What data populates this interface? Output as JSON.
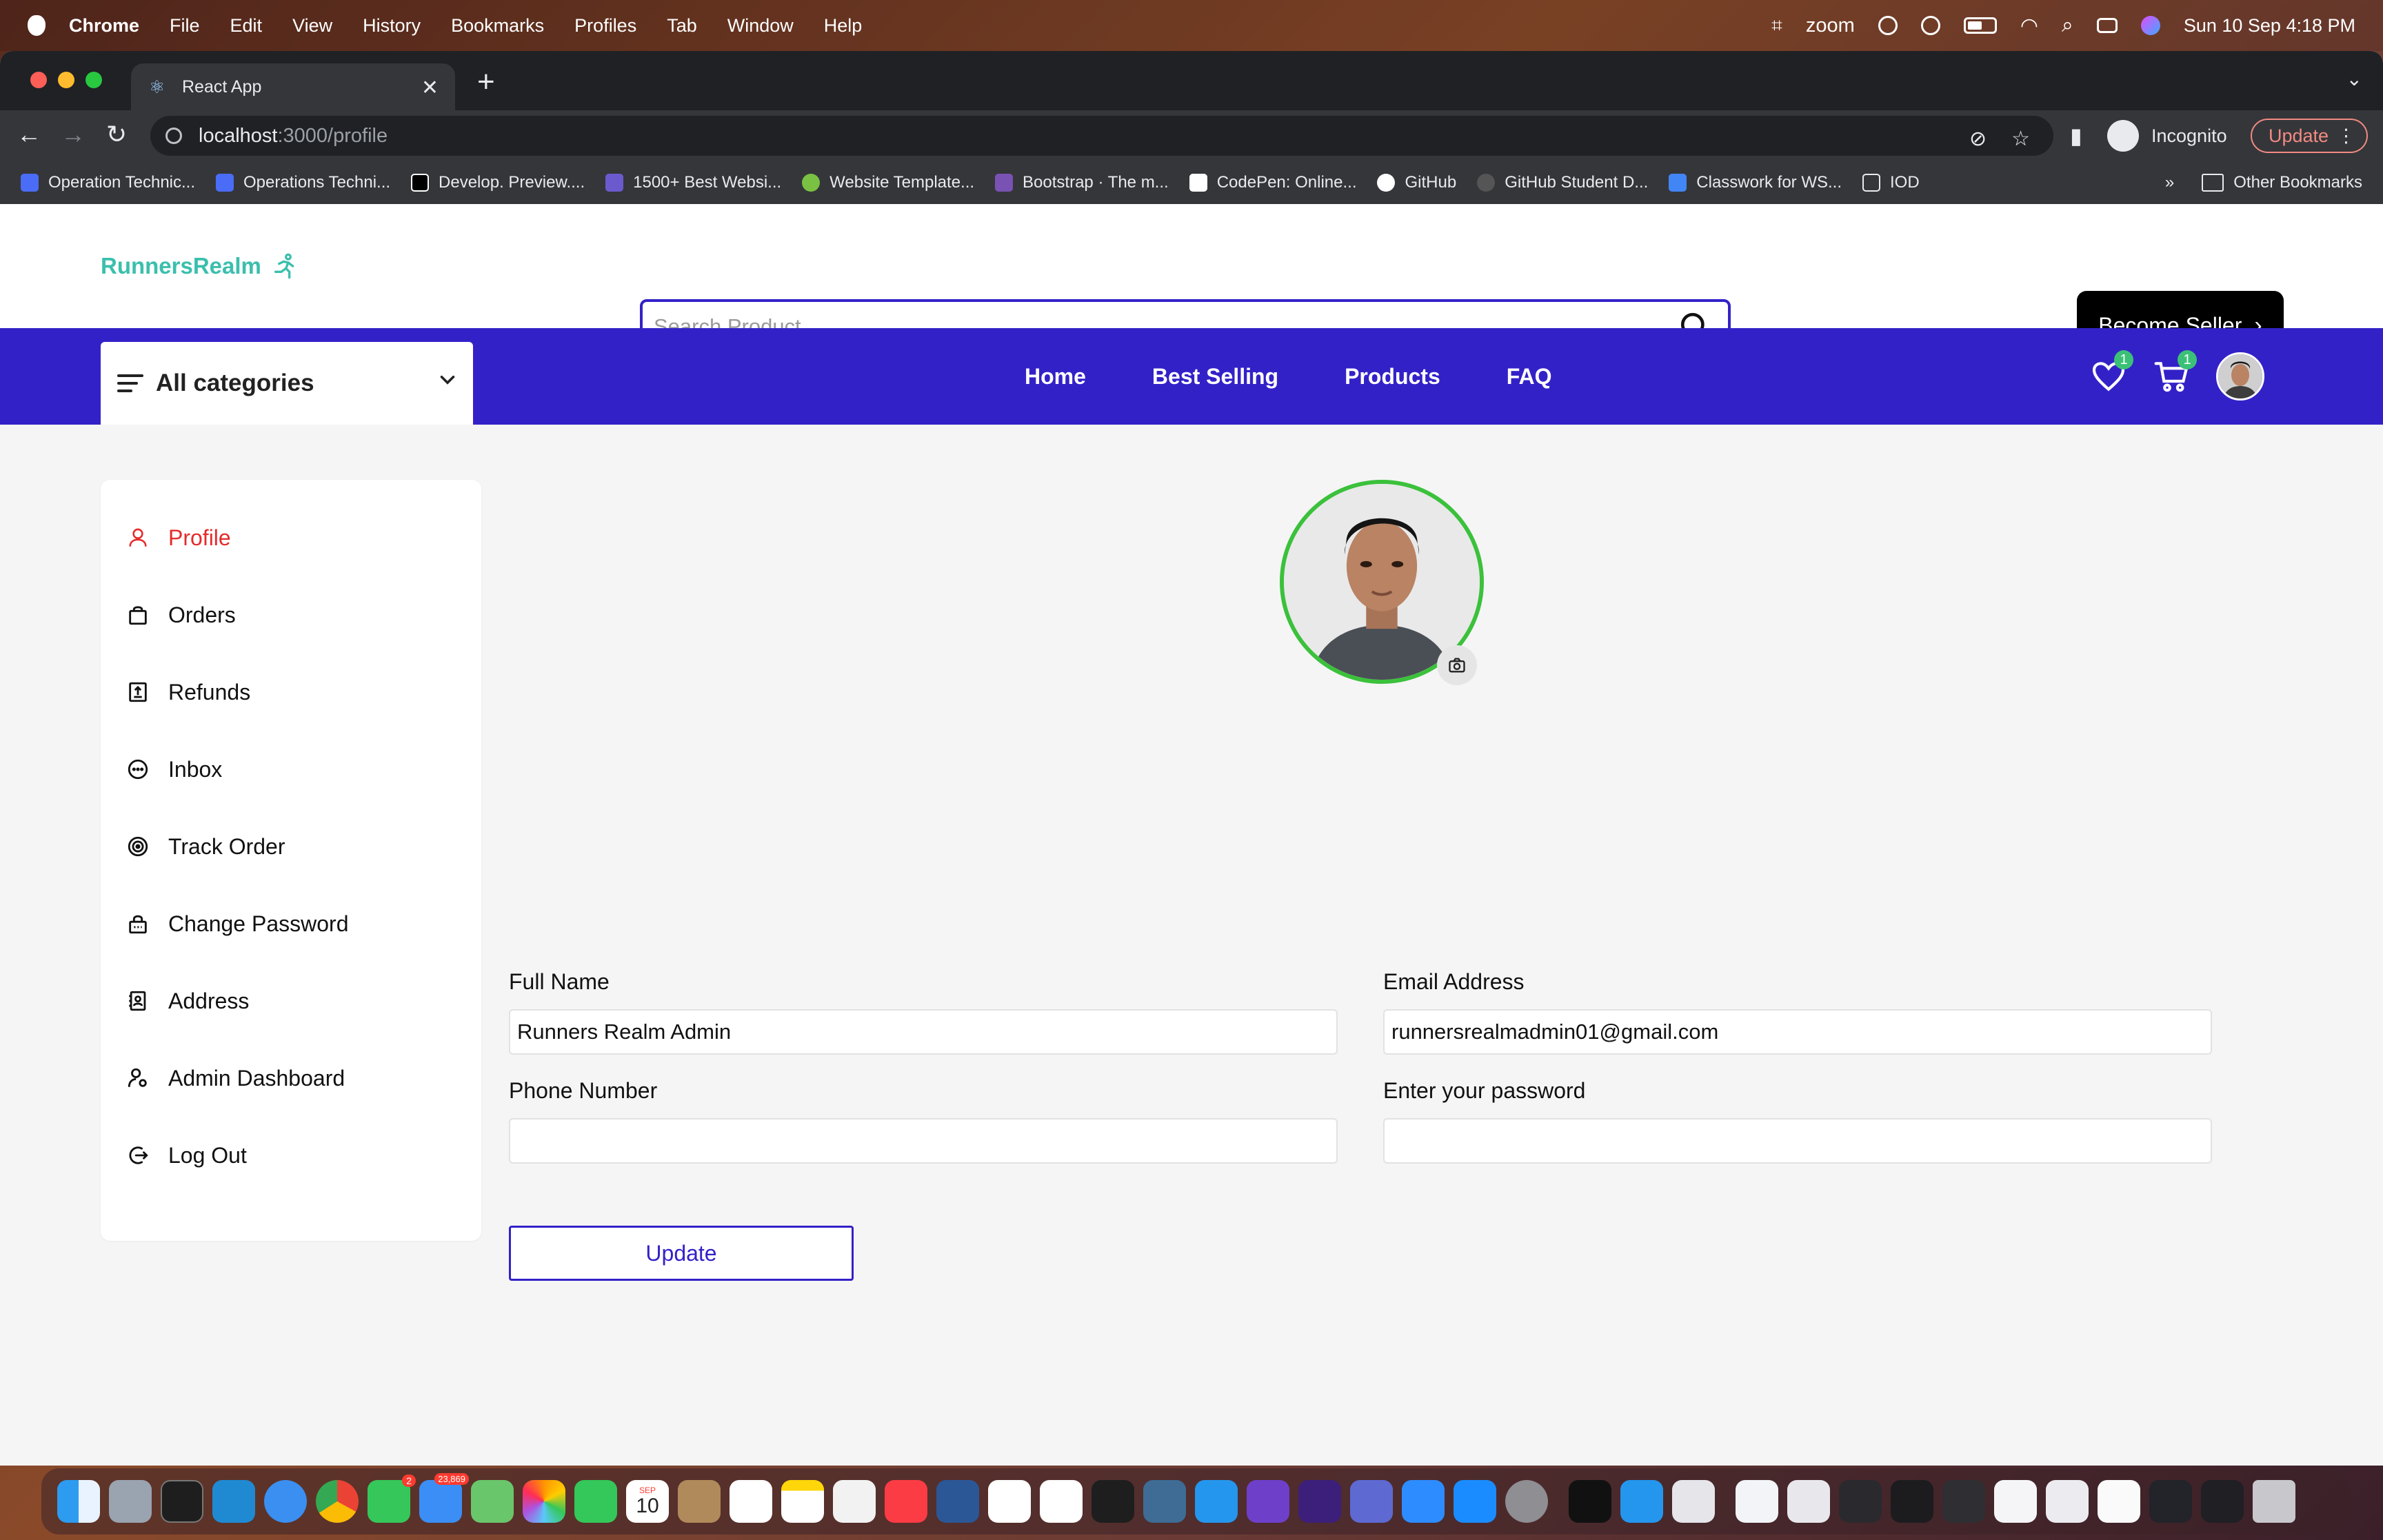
{
  "menubar": {
    "app": "Chrome",
    "items": [
      "File",
      "Edit",
      "View",
      "History",
      "Bookmarks",
      "Profiles",
      "Tab",
      "Window",
      "Help"
    ],
    "zoom": "zoom",
    "datetime": "Sun 10 Sep  4:18 PM"
  },
  "browser": {
    "tab_title": "React App",
    "url_host": "localhost",
    "url_path": ":3000/profile",
    "profile": "Incognito",
    "update_label": "Update",
    "bookmarks": [
      "Operation Technic...",
      "Operations Techni...",
      "Develop. Preview....",
      "1500+ Best Websi...",
      "Website Template...",
      "Bootstrap · The m...",
      "CodePen: Online...",
      "GitHub",
      "GitHub Student D...",
      "Classwork for WS...",
      "IOD"
    ],
    "other_bookmarks": "Other Bookmarks"
  },
  "header": {
    "logo": "RunnersRealm",
    "search_placeholder": "Search Product...",
    "seller_button": "Become Seller"
  },
  "navbar": {
    "categories_label": "All categories",
    "links": [
      "Home",
      "Best Selling",
      "Products",
      "FAQ"
    ],
    "wishlist_count": "1",
    "cart_count": "1"
  },
  "sidebar": {
    "items": [
      {
        "label": "Profile",
        "icon": "user-icon"
      },
      {
        "label": "Orders",
        "icon": "bag-icon"
      },
      {
        "label": "Refunds",
        "icon": "receipt-icon"
      },
      {
        "label": "Inbox",
        "icon": "chat-icon"
      },
      {
        "label": "Track Order",
        "icon": "track-icon"
      },
      {
        "label": "Change Password",
        "icon": "lock-icon"
      },
      {
        "label": "Address",
        "icon": "address-book-icon"
      },
      {
        "label": "Admin Dashboard",
        "icon": "admin-user-icon"
      },
      {
        "label": "Log Out",
        "icon": "logout-icon"
      }
    ],
    "active": "Profile"
  },
  "profile_form": {
    "full_name_label": "Full Name",
    "full_name_value": "Runners Realm Admin",
    "email_label": "Email Address",
    "email_value": "runnersrealmadmin01@gmail.com",
    "phone_label": "Phone Number",
    "phone_value": "",
    "password_label": "Enter your password",
    "password_value": "",
    "submit_label": "Update"
  },
  "colors": {
    "brand_blue": "#3321c8",
    "logo_teal": "#3bbfad",
    "active_red": "#e52b2b",
    "avatar_ring": "#3bc13b",
    "badge_green": "#3bc177"
  },
  "dock": {
    "mail_badge": "23,869",
    "messages_badge": "2",
    "calendar_month": "SEP",
    "calendar_day": "10"
  }
}
